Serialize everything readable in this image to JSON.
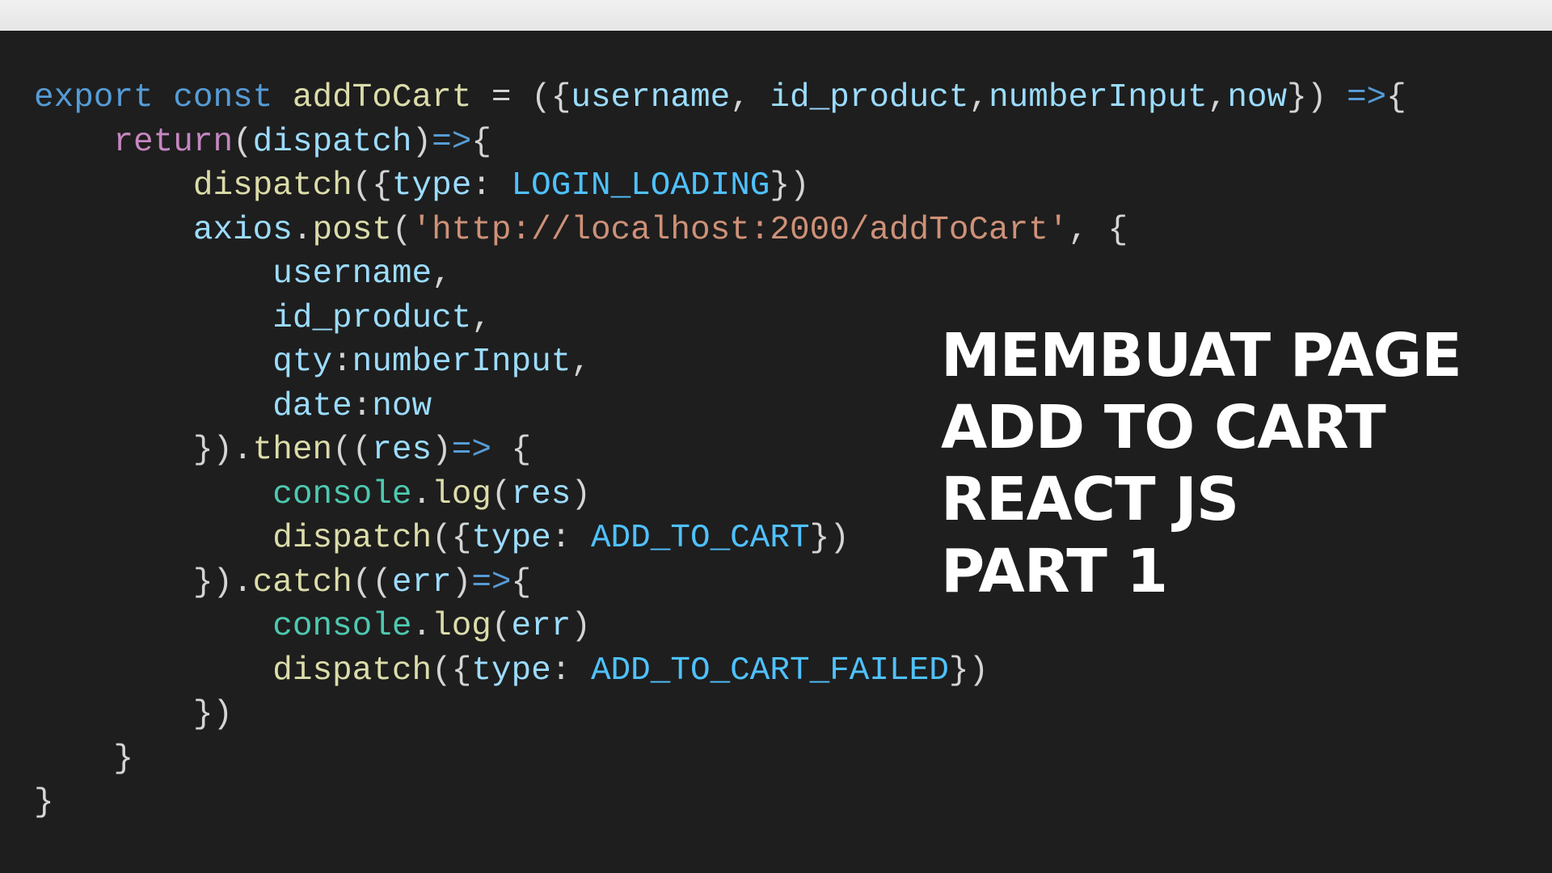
{
  "code_lines": [
    [
      [
        "kw",
        "export"
      ],
      [
        "p",
        " "
      ],
      [
        "kw",
        "const"
      ],
      [
        "p",
        " "
      ],
      [
        "fn",
        "addToCart"
      ],
      [
        "p",
        " = ({"
      ],
      [
        "var",
        "username"
      ],
      [
        "p",
        ", "
      ],
      [
        "var",
        "id_product"
      ],
      [
        "p",
        ","
      ],
      [
        "var",
        "numberInput"
      ],
      [
        "p",
        ","
      ],
      [
        "var",
        "now"
      ],
      [
        "p",
        "}) "
      ],
      [
        "kw",
        "=>"
      ],
      [
        "p",
        "{"
      ]
    ],
    [
      [
        "p",
        "    "
      ],
      [
        "ctl",
        "return"
      ],
      [
        "p",
        "("
      ],
      [
        "var",
        "dispatch"
      ],
      [
        "p",
        ")"
      ],
      [
        "kw",
        "=>"
      ],
      [
        "p",
        "{"
      ]
    ],
    [
      [
        "p",
        "        "
      ],
      [
        "fn",
        "dispatch"
      ],
      [
        "p",
        "({"
      ],
      [
        "var",
        "type"
      ],
      [
        "p",
        ": "
      ],
      [
        "const",
        "LOGIN_LOADING"
      ],
      [
        "p",
        "})"
      ]
    ],
    [
      [
        "p",
        "        "
      ],
      [
        "var",
        "axios"
      ],
      [
        "p",
        "."
      ],
      [
        "fn",
        "post"
      ],
      [
        "p",
        "("
      ],
      [
        "str",
        "'http://localhost:2000/addToCart'"
      ],
      [
        "p",
        ", {"
      ]
    ],
    [
      [
        "p",
        "            "
      ],
      [
        "var",
        "username"
      ],
      [
        "p",
        ","
      ]
    ],
    [
      [
        "p",
        "            "
      ],
      [
        "var",
        "id_product"
      ],
      [
        "p",
        ","
      ]
    ],
    [
      [
        "p",
        "            "
      ],
      [
        "var",
        "qty"
      ],
      [
        "p",
        ":"
      ],
      [
        "var",
        "numberInput"
      ],
      [
        "p",
        ","
      ]
    ],
    [
      [
        "p",
        "            "
      ],
      [
        "var",
        "date"
      ],
      [
        "p",
        ":"
      ],
      [
        "var",
        "now"
      ]
    ],
    [
      [
        "p",
        "        })."
      ],
      [
        "fn",
        "then"
      ],
      [
        "p",
        "(("
      ],
      [
        "var",
        "res"
      ],
      [
        "p",
        ")"
      ],
      [
        "kw",
        "=>"
      ],
      [
        "p",
        " {"
      ]
    ],
    [
      [
        "p",
        "            "
      ],
      [
        "class",
        "console"
      ],
      [
        "p",
        "."
      ],
      [
        "fn",
        "log"
      ],
      [
        "p",
        "("
      ],
      [
        "var",
        "res"
      ],
      [
        "p",
        ")"
      ]
    ],
    [
      [
        "p",
        "            "
      ],
      [
        "fn",
        "dispatch"
      ],
      [
        "p",
        "({"
      ],
      [
        "var",
        "type"
      ],
      [
        "p",
        ": "
      ],
      [
        "const",
        "ADD_TO_CART"
      ],
      [
        "p",
        "})"
      ]
    ],
    [
      [
        "p",
        "        })."
      ],
      [
        "fn",
        "catch"
      ],
      [
        "p",
        "(("
      ],
      [
        "var",
        "err"
      ],
      [
        "p",
        ")"
      ],
      [
        "kw",
        "=>"
      ],
      [
        "p",
        "{"
      ]
    ],
    [
      [
        "p",
        "            "
      ],
      [
        "class",
        "console"
      ],
      [
        "p",
        "."
      ],
      [
        "fn",
        "log"
      ],
      [
        "p",
        "("
      ],
      [
        "var",
        "err"
      ],
      [
        "p",
        ")"
      ]
    ],
    [
      [
        "p",
        "            "
      ],
      [
        "fn",
        "dispatch"
      ],
      [
        "p",
        "({"
      ],
      [
        "var",
        "type"
      ],
      [
        "p",
        ": "
      ],
      [
        "const",
        "ADD_TO_CART_FAILED"
      ],
      [
        "p",
        "})"
      ]
    ],
    [
      [
        "p",
        "        })"
      ]
    ],
    [
      [
        "p",
        "    }"
      ]
    ],
    [
      [
        "p",
        "}"
      ]
    ]
  ],
  "overlay_title": {
    "line1": "MEMBUAT PAGE",
    "line2": "ADD TO CART",
    "line3": "REACT JS",
    "line4": "PART 1"
  },
  "colors": {
    "background": "#1e1e1e",
    "control_keyword": "#c586c0",
    "keyword": "#569cd6",
    "function": "#dcdcaa",
    "variable": "#9cdcfe",
    "string": "#ce9178",
    "class": "#4ec9b0",
    "constant": "#4fc1ff",
    "punctuation": "#d4d4d4",
    "title": "#ffffff"
  }
}
